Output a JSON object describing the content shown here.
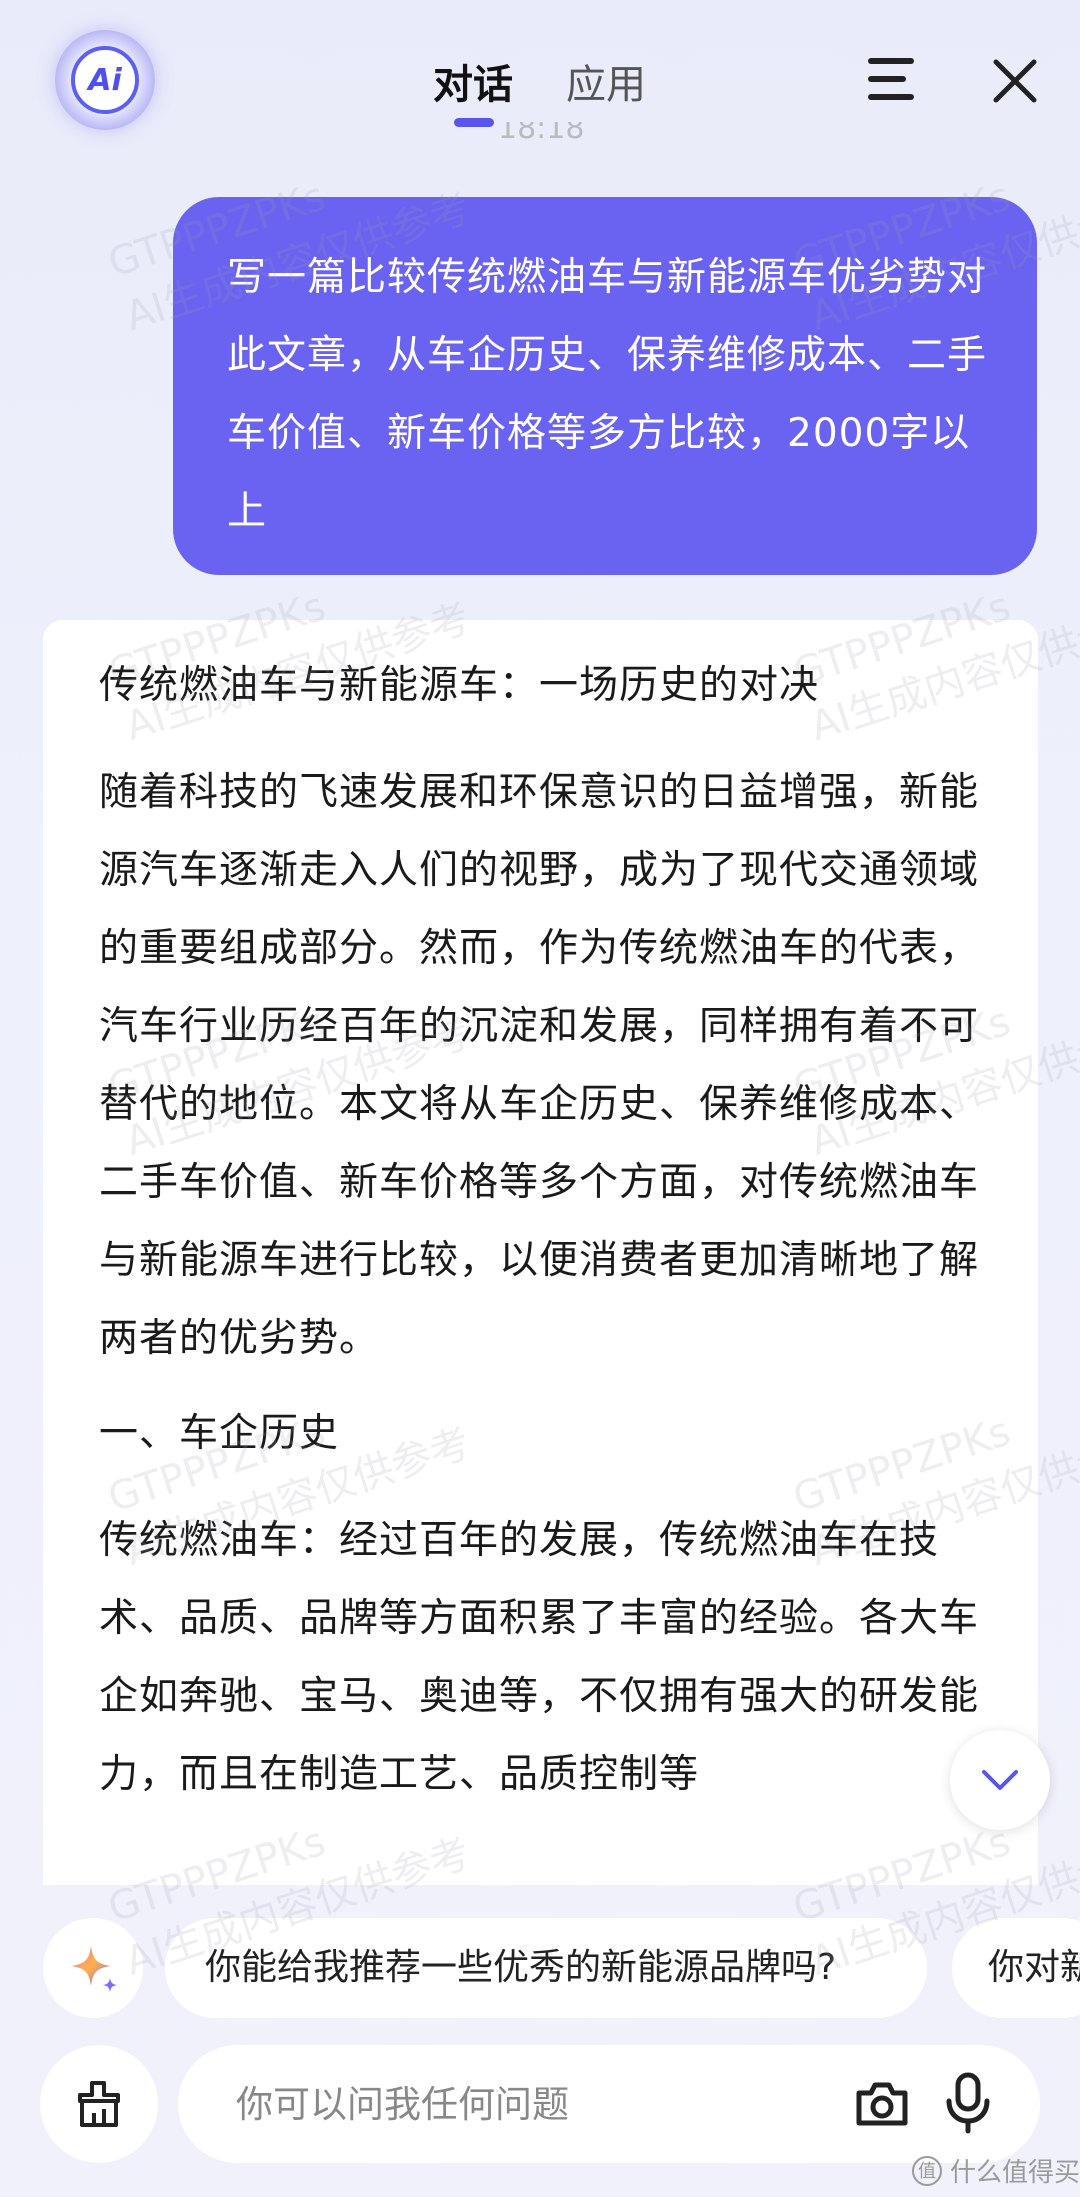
{
  "header": {
    "logo_text": "Ai",
    "tabs": [
      {
        "label": "对话",
        "active": true
      },
      {
        "label": "应用",
        "active": false
      }
    ],
    "time_peek": "18:18"
  },
  "conversation": {
    "user_message": "写一篇比较传统燃油车与新能源车优劣势对此文章，从车企历史、保养维修成本、二手车价值、新车价格等多方比较，2000字以上",
    "answer": {
      "title": "传统燃油车与新能源车：一场历史的对决",
      "intro": "随着科技的飞速发展和环保意识的日益增强，新能源汽车逐渐走入人们的视野，成为了现代交通领域的重要组成部分。然而，作为传统燃油车的代表，汽车行业历经百年的沉淀和发展，同样拥有着不可替代的地位。本文将从车企历史、保养维修成本、二手车价值、新车价格等多个方面，对传统燃油车与新能源车进行比较，以便消费者更加清晰地了解两者的优劣势。",
      "section1_heading": "一、车企历史",
      "section1_para": "传统燃油车：经过百年的发展，传统燃油车在技术、品质、品牌等方面积累了丰富的经验。各大车企如奔驰、宝马、奥迪等，不仅拥有强大的研发能力，而且在制造工艺、品质控制等"
    }
  },
  "suggestions": [
    "你能给我推荐一些优秀的新能源品牌吗?",
    "你对新"
  ],
  "input": {
    "placeholder": "你可以问我任何问题"
  },
  "watermark": {
    "line1": "GTPPPZPKs",
    "line2": "AI生成内容仅供参考"
  },
  "footer": {
    "logo_text": "什么值得买",
    "logo_mark": "值"
  },
  "colors": {
    "accent": "#6a62f0",
    "background": "#eef0fb"
  }
}
